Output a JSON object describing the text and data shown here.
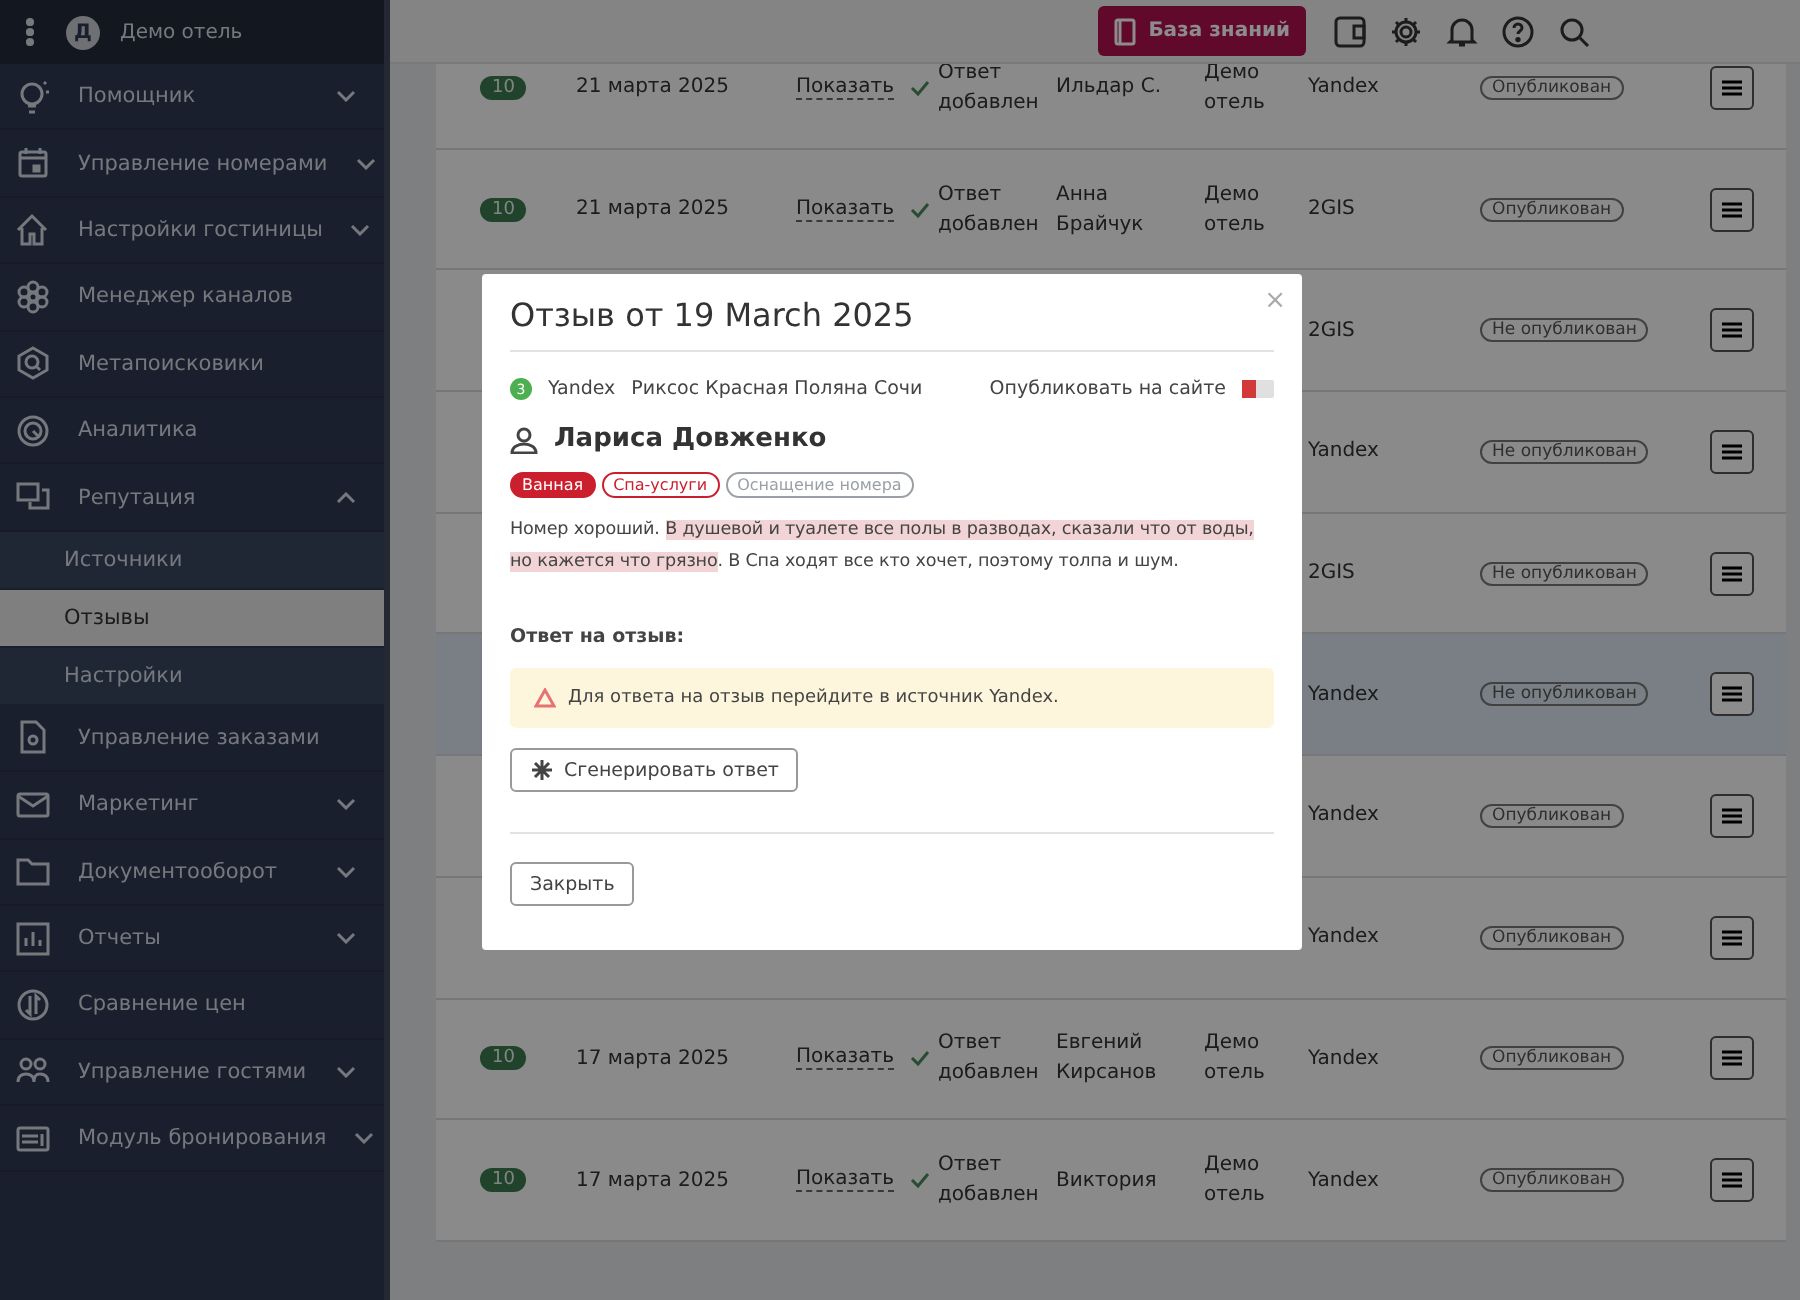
{
  "sidebar": {
    "hotel_initial": "Д",
    "hotel_name": "Демо отель",
    "items": [
      {
        "label": "Помощник",
        "expanded": false
      },
      {
        "label": "Управление номерами",
        "expanded": false
      },
      {
        "label": "Настройки гостиницы",
        "expanded": false
      },
      {
        "label": "Менеджер каналов"
      },
      {
        "label": "Метапоисковики"
      },
      {
        "label": "Аналитика"
      },
      {
        "label": "Репутация",
        "expanded": true,
        "children": [
          {
            "label": "Источники",
            "selected": false
          },
          {
            "label": "Отзывы",
            "selected": true
          },
          {
            "label": "Настройки",
            "selected": false
          }
        ]
      },
      {
        "label": "Управление заказами"
      },
      {
        "label": "Маркетинг",
        "expanded": false
      },
      {
        "label": "Документооборот",
        "expanded": false
      },
      {
        "label": "Отчеты",
        "expanded": false
      },
      {
        "label": "Сравнение цен"
      },
      {
        "label": "Управление гостями",
        "expanded": false
      },
      {
        "label": "Модуль бронирования",
        "expanded": false
      }
    ]
  },
  "header": {
    "knowledge_button": "База знаний"
  },
  "table": {
    "rows": [
      {
        "rating": "10",
        "date": "21 марта 2025",
        "link": "Показать",
        "status": "Ответ добавлен",
        "author": "Ильдар С.",
        "hotel": "Демо отель",
        "platform": "Yandex",
        "published": "Опубликован",
        "selected": false
      },
      {
        "rating": "10",
        "date": "21 марта 2025",
        "link": "Показать",
        "status": "Ответ добавлен",
        "author": "Анна Брайчук",
        "hotel": "Демо отель",
        "platform": "2GIS",
        "published": "Опубликован",
        "selected": false
      },
      {
        "platform": "2GIS",
        "published": "Не опубликован",
        "selected": false
      },
      {
        "platform": "Yandex",
        "published": "Не опубликован",
        "selected": false
      },
      {
        "platform": "2GIS",
        "published": "Не опубликован",
        "selected": false
      },
      {
        "platform": "Yandex",
        "published": "Не опубликован",
        "selected": true
      },
      {
        "platform": "Yandex",
        "published": "Опубликован",
        "selected": false
      },
      {
        "platform": "Yandex",
        "published": "Опубликован",
        "selected": false
      },
      {
        "rating": "10",
        "date": "17 марта 2025",
        "link": "Показать",
        "status": "Ответ добавлен",
        "author": "Евгений Кирсанов",
        "hotel": "Демо отель",
        "platform": "Yandex",
        "published": "Опубликован",
        "selected": false
      },
      {
        "rating": "10",
        "date": "17 марта 2025",
        "link": "Показать",
        "status": "Ответ добавлен",
        "author": "Виктория",
        "hotel": "Демо отель",
        "platform": "Yandex",
        "published": "Опубликован",
        "selected": false
      }
    ]
  },
  "modal": {
    "title": "Отзыв от 19 March 2025",
    "source_rating": "3",
    "source": "Yandex",
    "property": "Риксос Красная Поляна Сочи",
    "publish_label": "Опубликовать на сайте",
    "publish_on": false,
    "author": "Лариса Довженко",
    "tags": [
      {
        "label": "Ванная",
        "color": "#cc1f2d",
        "selected": true
      },
      {
        "label": "Спа-услуги",
        "color": "#cc1f2d",
        "selected": false
      },
      {
        "label": "Оснащение номера",
        "color": "#9aa0a6",
        "selected": false
      }
    ],
    "review": [
      {
        "text": "Номер хороший. ",
        "highlighted": false
      },
      {
        "text": "В душевой и туалете все полы в разводах, сказали что от воды, но кажется что грязно",
        "highlighted": true
      },
      {
        "text": ". В Спа ходят все кто хочет, поэтому толпа и шум.",
        "highlighted": false
      }
    ],
    "reply_heading": "Ответ на отзыв:",
    "warning": "Для ответа на отзыв перейдите в источник Yandex.",
    "generate_button": "Сгенерировать ответ",
    "close_button": "Закрыть",
    "close_icon": "×"
  }
}
